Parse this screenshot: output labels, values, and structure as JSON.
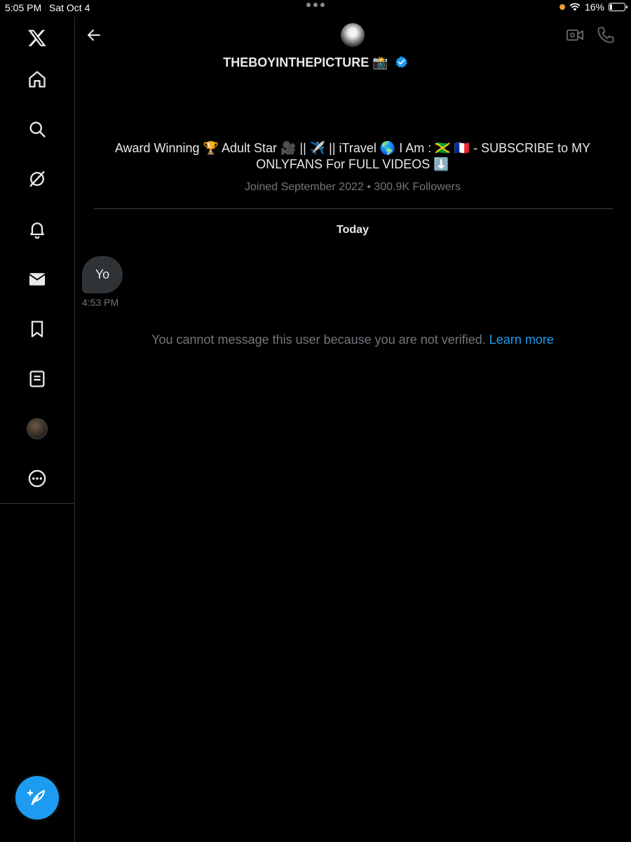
{
  "status_bar": {
    "time": "5:05 PM",
    "date": "Sat Oct 4",
    "battery_text": "16%",
    "battery_level": 0.16
  },
  "sidebar": {
    "items": [
      {
        "name": "home",
        "icon": "home-icon"
      },
      {
        "name": "explore",
        "icon": "search-icon"
      },
      {
        "name": "grok",
        "icon": "slash-circle-icon"
      },
      {
        "name": "notifications",
        "icon": "bell-icon"
      },
      {
        "name": "messages",
        "icon": "envelope-icon"
      },
      {
        "name": "bookmarks",
        "icon": "bookmark-icon"
      },
      {
        "name": "lists",
        "icon": "list-document-icon"
      },
      {
        "name": "profile",
        "icon": "avatar"
      },
      {
        "name": "more",
        "icon": "more-circle-icon"
      }
    ],
    "compose_icon": "compose-feather-icon"
  },
  "conversation": {
    "display_name": "THEBOYINTHEPICTURE 📸",
    "bio": "Award Winning 🏆 Adult Star 🎥 || ✈️ || iTravel 🌎 I Am : 🇯🇲  🇫🇷 -  SUBSCRIBE to MY ONLYFANS For FULL VIDEOS ⬇️",
    "meta": "Joined September 2022 • 300.9K Followers",
    "day_label": "Today",
    "messages": [
      {
        "text": "Yo",
        "time": "4:53 PM"
      }
    ],
    "notice": "You cannot message this user because you are not verified.",
    "learn_more": "Learn more"
  },
  "colors": {
    "background": "#000000",
    "accent": "#1d9bf0",
    "muted_text": "#71767b",
    "bubble": "#2f3336"
  }
}
